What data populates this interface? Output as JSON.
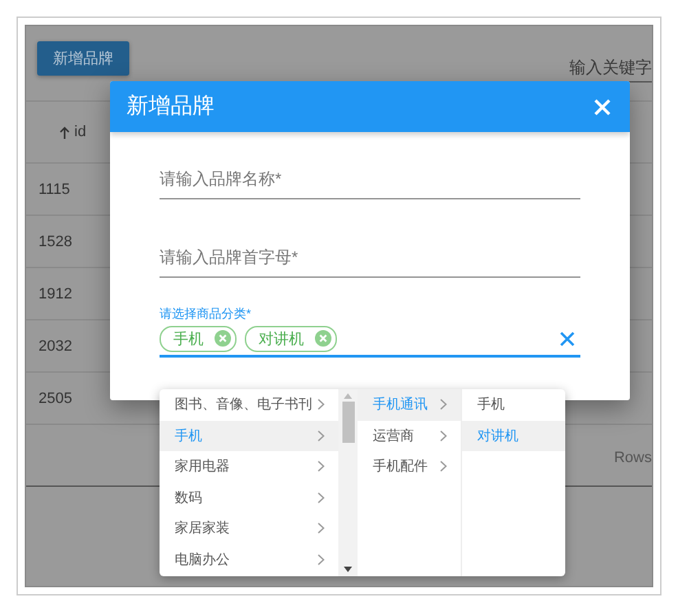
{
  "page": {
    "add_button": "新增品牌",
    "search": {
      "placeholder": "输入关键字"
    },
    "table": {
      "columns": [
        {
          "label": "id",
          "sorted_ascending": true
        }
      ],
      "rows": [
        [
          "1115"
        ],
        [
          "1528"
        ],
        [
          "1912"
        ],
        [
          "2032"
        ],
        [
          "2505"
        ]
      ]
    },
    "footer": {
      "rows_label": "Rows"
    }
  },
  "dialog": {
    "title": "新增品牌",
    "fields": [
      {
        "kind": "text",
        "placeholder": "请输入品牌名称*"
      },
      {
        "kind": "text",
        "placeholder": "请输入品牌首字母*"
      },
      {
        "kind": "cascader",
        "label": "请选择商品分类*",
        "focused": true,
        "chips": [
          "手机",
          "对讲机"
        ]
      }
    ]
  },
  "dropdown": {
    "columns": [
      [
        {
          "label": "图书、音像、电子书刊",
          "selected": false,
          "has_children": true
        },
        {
          "label": "手机",
          "selected": true,
          "has_children": true
        },
        {
          "label": "家用电器",
          "selected": false,
          "has_children": true
        },
        {
          "label": "数码",
          "selected": false,
          "has_children": true
        },
        {
          "label": "家居家装",
          "selected": false,
          "has_children": true
        },
        {
          "label": "电脑办公",
          "selected": false,
          "has_children": true
        }
      ],
      [
        {
          "label": "手机通讯",
          "selected": true,
          "has_children": true
        },
        {
          "label": "运营商",
          "selected": false,
          "has_children": true
        },
        {
          "label": "手机配件",
          "selected": false,
          "has_children": true
        }
      ],
      [
        {
          "label": "手机",
          "selected": false,
          "has_children": false
        },
        {
          "label": "对讲机",
          "selected": true,
          "has_children": false
        }
      ]
    ]
  }
}
